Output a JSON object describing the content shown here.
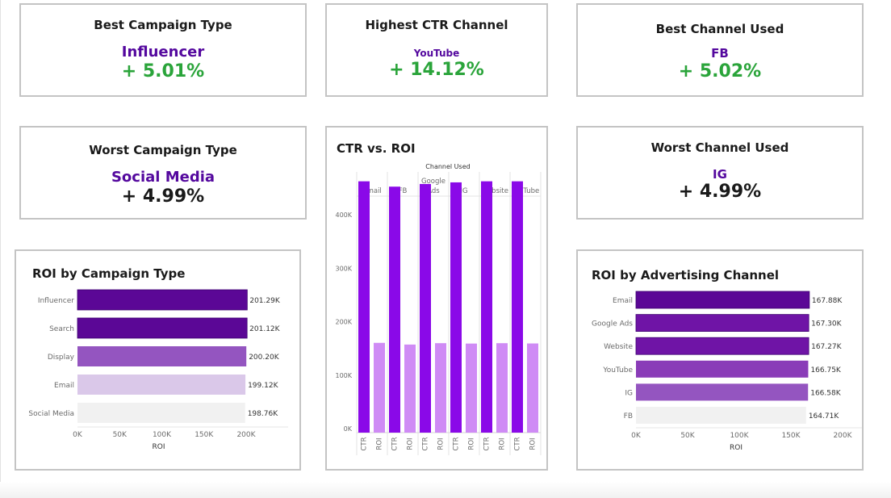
{
  "kpis": {
    "best_campaign": {
      "title": "Best Campaign Type",
      "name": "Influencer",
      "value": "+ 5.01%"
    },
    "highest_ctr": {
      "title": "Highest CTR Channel",
      "name": "YouTube",
      "value": "+ 14.12%"
    },
    "best_channel": {
      "title": "Best Channel Used",
      "name": "FB",
      "value": "+ 5.02%"
    },
    "worst_campaign": {
      "title": "Worst Campaign Type",
      "name": "Social Media",
      "value": "+ 4.99%"
    },
    "worst_channel": {
      "title": "Worst Channel Used",
      "name": "IG",
      "value": "+ 4.99%"
    }
  },
  "colors": {
    "accent_purple": "#54089e",
    "positive_green": "#2aa43a",
    "bar_dark": "#5b0796",
    "bar_mid": "#9455c0",
    "bar_light": "#dac8e9",
    "bar_pale": "#f1f1f1",
    "ctr_bar": "#8a09e8",
    "roi_bar": "#cf8bf5"
  },
  "chart_data": [
    {
      "type": "bar",
      "orientation": "horizontal",
      "title": "ROI by Campaign Type",
      "categories": [
        "Influencer",
        "Search",
        "Display",
        "Email",
        "Social Media"
      ],
      "values": [
        201290,
        201120,
        200200,
        199120,
        198760
      ],
      "value_labels": [
        "201.29K",
        "201.12K",
        "200.20K",
        "199.12K",
        "198.76K"
      ],
      "bar_colors": [
        "#5b0796",
        "#5b0796",
        "#9455c0",
        "#dac8e9",
        "#f1f1f1"
      ],
      "xlabel": "ROI",
      "xlim": [
        0,
        200000
      ],
      "xticks": [
        "0K",
        "50K",
        "100K",
        "150K",
        "200K"
      ]
    },
    {
      "type": "bar",
      "title": "CTR vs. ROI",
      "column_header": "Channel Used",
      "groups": [
        "Email",
        "FB",
        "Google Ads",
        "IG",
        "Website",
        "YouTube"
      ],
      "measures": [
        "CTR",
        "ROI"
      ],
      "series": [
        {
          "name": "CTR",
          "values": [
            470000,
            460000,
            465000,
            468000,
            470000,
            470000
          ]
        },
        {
          "name": "ROI",
          "values": [
            167880,
            164710,
            167300,
            166580,
            167270,
            166750
          ]
        }
      ],
      "ylim": [
        0,
        480000
      ],
      "yticks": [
        "0K",
        "100K",
        "200K",
        "300K",
        "400K"
      ],
      "grid": false
    },
    {
      "type": "bar",
      "orientation": "horizontal",
      "title": "ROI by Advertising Channel",
      "categories": [
        "Email",
        "Google Ads",
        "Website",
        "YouTube",
        "IG",
        "FB"
      ],
      "values": [
        167880,
        167300,
        167270,
        166750,
        166580,
        164710
      ],
      "value_labels": [
        "167.88K",
        "167.30K",
        "167.27K",
        "166.75K",
        "166.58K",
        "164.71K"
      ],
      "bar_colors": [
        "#5b0796",
        "#6f14a6",
        "#6f14a6",
        "#8a3cb8",
        "#9455c0",
        "#f1f1f1"
      ],
      "xlabel": "ROI",
      "xlim": [
        0,
        200000
      ],
      "xticks": [
        "0K",
        "50K",
        "100K",
        "150K",
        "200K"
      ]
    }
  ]
}
